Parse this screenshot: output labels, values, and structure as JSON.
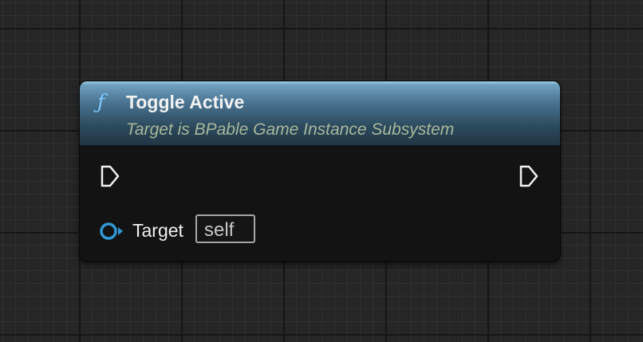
{
  "node": {
    "title": "Toggle Active",
    "subtitle": "Target is BPable Game Instance Subsystem",
    "icon": "function-icon",
    "header_color": "#4d7896",
    "pins": {
      "exec_in": "exec-input-pin",
      "exec_out": "exec-output-pin",
      "target": {
        "label": "Target",
        "value": "self",
        "color": "#2f98d6"
      }
    }
  }
}
